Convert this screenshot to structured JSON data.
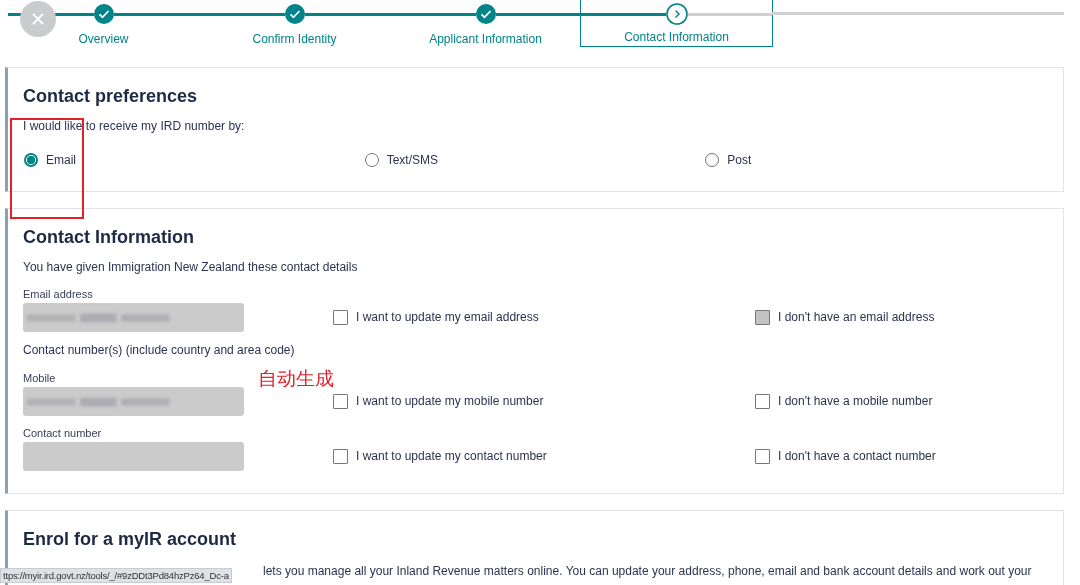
{
  "stepper": {
    "steps": [
      {
        "label": "Overview",
        "selected": false
      },
      {
        "label": "Confirm Identity",
        "selected": false
      },
      {
        "label": "Applicant Information",
        "selected": false
      },
      {
        "label": "Contact Information",
        "selected": true
      }
    ]
  },
  "contact_preferences": {
    "title": "Contact preferences",
    "prompt": "I would like to receive my IRD number by:",
    "options": [
      {
        "label": "Email",
        "selected": true
      },
      {
        "label": "Text/SMS",
        "selected": false
      },
      {
        "label": "Post",
        "selected": false
      }
    ]
  },
  "contact_information": {
    "title": "Contact Information",
    "intro": "You have given Immigration New Zealand these contact details",
    "items": [
      {
        "kind": "field",
        "label": "Email address",
        "redacted": true,
        "update": {
          "label": "I want to update my email address",
          "checked": false
        },
        "none": {
          "label": "I don't have an email address",
          "checked": false,
          "disabled": true
        }
      },
      {
        "kind": "heading",
        "label": "Contact number(s) (include country and area code)"
      },
      {
        "kind": "field",
        "label": "Mobile",
        "redacted": true,
        "update": {
          "label": "I want to update my mobile number",
          "checked": false
        },
        "none": {
          "label": "I don't have a mobile number",
          "checked": false,
          "disabled": false
        }
      },
      {
        "kind": "field",
        "label": "Contact number",
        "redacted": false,
        "update": {
          "label": "I want to update my contact number",
          "checked": false
        },
        "none": {
          "label": "I don't have a contact number",
          "checked": false,
          "disabled": false
        }
      }
    ]
  },
  "enrol": {
    "title": "Enrol for a myIR account",
    "text": "lets you manage all your Inland Revenue matters online. You can update your address, phone, email and bank account details and work out your"
  },
  "status_bar": {
    "url": "ttps://myir.ird.govt.nz/tools/_/#9zDDt3Pd84hzPz64_Dc-a"
  },
  "annotations": [
    {
      "kind": "box"
    },
    {
      "kind": "note",
      "text": "自动生成"
    }
  ]
}
